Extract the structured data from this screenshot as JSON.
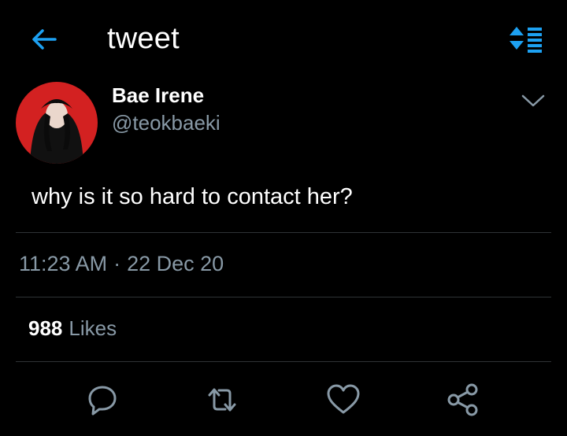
{
  "header": {
    "title": "tweet"
  },
  "author": {
    "display_name": "Bae Irene",
    "handle": "@teokbaeki"
  },
  "tweet": {
    "text": "why is it so hard to contact her?",
    "time": "11:23 AM",
    "date": "22 Dec 20"
  },
  "stats": {
    "likes_count": "988",
    "likes_label": "Likes"
  },
  "icons": [
    "back-arrow-icon",
    "sort-icon",
    "chevron-down-icon",
    "reply-icon",
    "retweet-icon",
    "like-icon",
    "share-icon"
  ],
  "colors": {
    "accent": "#1da1f2",
    "background": "#000000",
    "muted": "#8899a6",
    "divider": "#2f3336",
    "avatar_bg": "#d32121"
  }
}
